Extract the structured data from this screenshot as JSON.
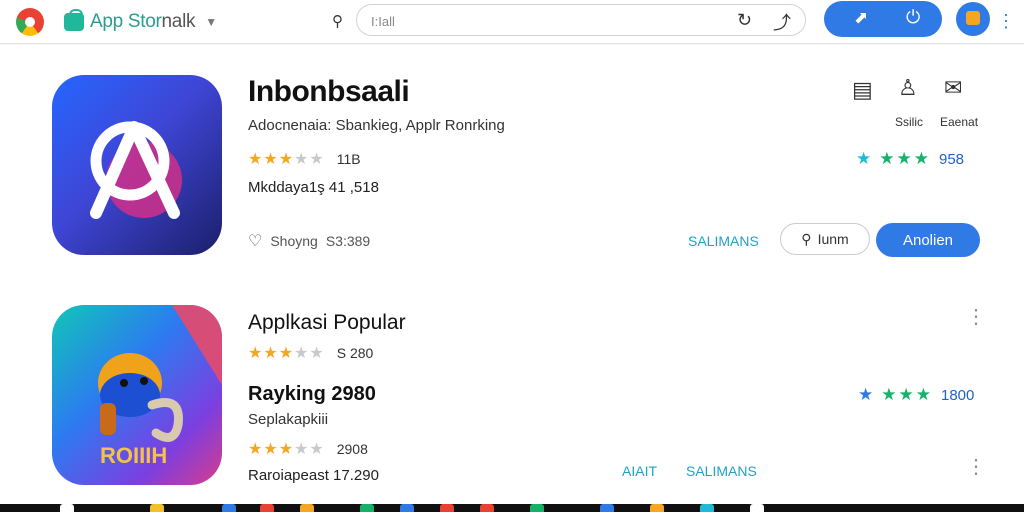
{
  "header": {
    "store_name_part1": "App Stor",
    "store_name_part2": "nalk",
    "address_value": "I:Iall",
    "icons": [
      "browser-logo",
      "store-bag-icon",
      "chevron-down-icon",
      "pin-icon",
      "reload-icon",
      "share-icon",
      "open-external-icon",
      "power-icon",
      "profile-icon",
      "more-vert-icon"
    ]
  },
  "featured": {
    "title": "Inbonbsaali",
    "subtitle": "Adocnenaia: Sbankieg, Applr Ronrking",
    "rating_value": "11B",
    "meta": "Mkddaya1ş 41 ,518",
    "likes_label": "Shoyng",
    "likes_value": "S3:389",
    "action_share_label": "Ssilic",
    "action_report_label": "Eaenat",
    "right_rating_value": "958",
    "link_label": "SALIMANS",
    "outline_button_label": "Iunm",
    "primary_button_label": "Anolien"
  },
  "popular": {
    "section_title": "Applkasi Popular",
    "rating_value": "S 280",
    "ranking_title": "Rayking 2980",
    "ranking_subtitle": "Seplakapkiii",
    "ranking_rating_value": "2908",
    "meta": "Raroiapeast 17.290",
    "right_rating_value": "1800",
    "link_a_label": "AIAIT",
    "link_b_label": "SALIMANS",
    "icon_label": "ROIIIH"
  },
  "colors": {
    "accent": "#2f7ae5",
    "star": "#f5a623",
    "rating_green": "#17b26a",
    "link_teal": "#1fa1c8"
  },
  "taskbar": {
    "icons": [
      "start-icon",
      "app-icon-1",
      "app-icon-2",
      "app-icon-3",
      "app-icon-4",
      "app-icon-5",
      "app-icon-6",
      "app-icon-7",
      "app-icon-8",
      "app-icon-9",
      "app-icon-10",
      "app-icon-11",
      "app-icon-12",
      "app-icon-13"
    ]
  }
}
